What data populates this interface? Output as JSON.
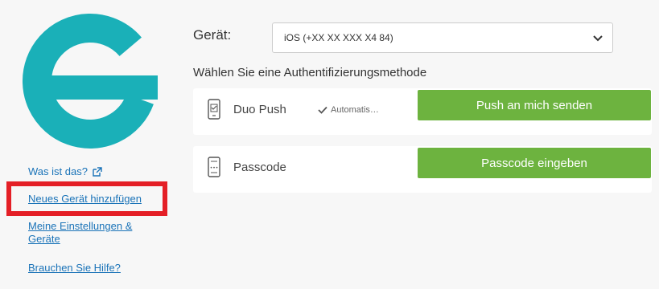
{
  "sidebar": {
    "what_is_this": "Was ist das?",
    "add_device": "Neues Gerät hinzufügen",
    "my_settings": "Meine Einstellungen & Geräte",
    "need_help": "Brauchen Sie Hilfe?"
  },
  "device": {
    "label": "Gerät:",
    "selected": "iOS (+XX XX XXX X4 84)"
  },
  "method_prompt": "Wählen Sie eine Authentifizierungsmethode",
  "methods": [
    {
      "name": "Duo Push",
      "auto_label": "Automatis…",
      "button": "Push an mich senden"
    },
    {
      "name": "Passcode",
      "button": "Passcode eingeben"
    }
  ],
  "colors": {
    "logo": "#1ab0b8",
    "button": "#6db33f",
    "link": "#1a73b8",
    "highlight": "#e41f26"
  }
}
